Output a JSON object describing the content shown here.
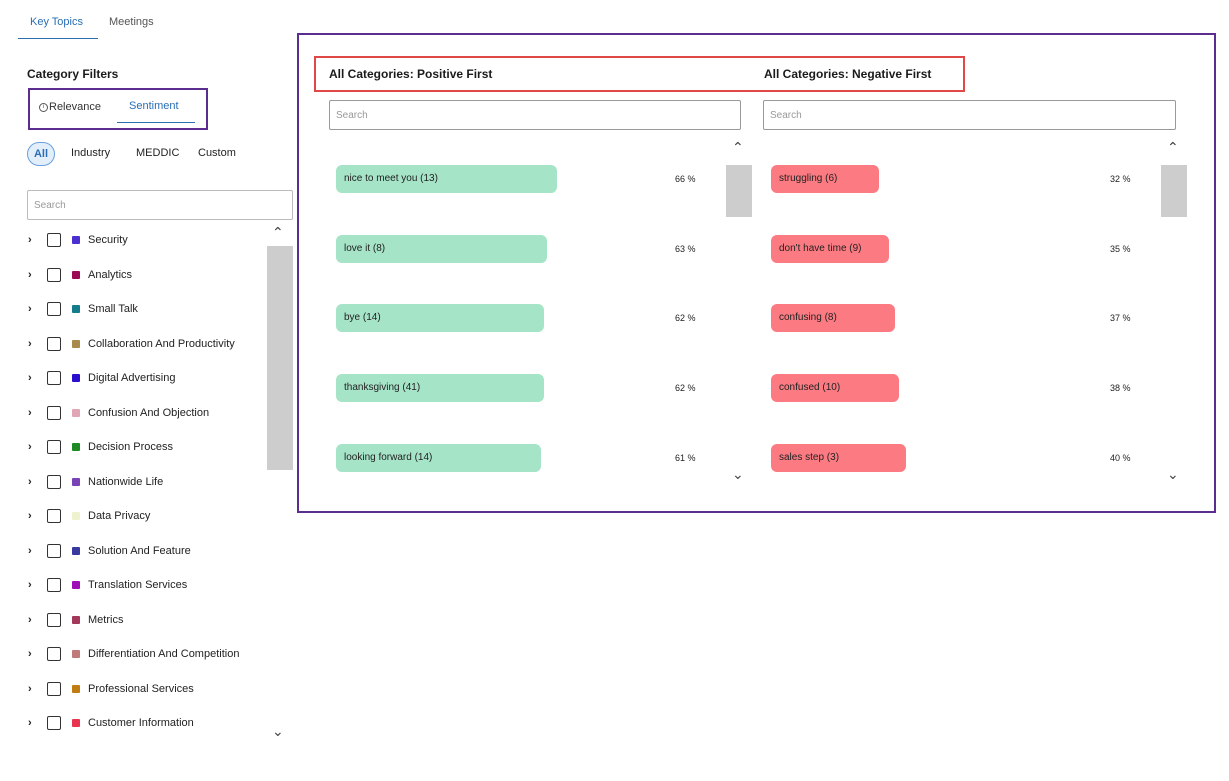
{
  "tabs": {
    "key_topics": "Key Topics",
    "meetings": "Meetings"
  },
  "category_filters": {
    "title": "Category Filters",
    "mode": {
      "relevance": "Relevance",
      "sentiment": "Sentiment"
    },
    "chips": {
      "all": "All",
      "industry": "Industry",
      "meddic": "MEDDIC",
      "custom": "Custom"
    },
    "search_placeholder": "Search",
    "categories": [
      {
        "label": "Security",
        "color": "#4b2fcf"
      },
      {
        "label": "Analytics",
        "color": "#9b0b55"
      },
      {
        "label": "Small Talk",
        "color": "#147c8a"
      },
      {
        "label": "Collaboration And Productivity",
        "color": "#a88a4a"
      },
      {
        "label": "Digital Advertising",
        "color": "#2a0fcf"
      },
      {
        "label": "Confusion And Objection",
        "color": "#e0a6b6"
      },
      {
        "label": "Decision Process",
        "color": "#1e8a22"
      },
      {
        "label": "Nationwide Life",
        "color": "#7a43b5"
      },
      {
        "label": "Data Privacy",
        "color": "#eef2cf"
      },
      {
        "label": "Solution And Feature",
        "color": "#3a3a9e"
      },
      {
        "label": "Translation Services",
        "color": "#9e0fb5"
      },
      {
        "label": "Metrics",
        "color": "#a3385a"
      },
      {
        "label": "Differentiation And Competition",
        "color": "#c07a7a"
      },
      {
        "label": "Professional Services",
        "color": "#c07b12"
      },
      {
        "label": "Customer Information",
        "color": "#e8344f"
      }
    ]
  },
  "positive": {
    "title": "All Categories: Positive First",
    "search_placeholder": "Search",
    "items": [
      {
        "label": "nice to meet you (13)",
        "pct": "66 %",
        "value": 66
      },
      {
        "label": "love it (8)",
        "pct": "63 %",
        "value": 63
      },
      {
        "label": "bye (14)",
        "pct": "62 %",
        "value": 62
      },
      {
        "label": "thanksgiving (41)",
        "pct": "62 %",
        "value": 62
      },
      {
        "label": "looking forward (14)",
        "pct": "61 %",
        "value": 61
      }
    ]
  },
  "negative": {
    "title": "All Categories: Negative First",
    "search_placeholder": "Search",
    "items": [
      {
        "label": "struggling (6)",
        "pct": "32 %",
        "value": 32
      },
      {
        "label": "don't have time (9)",
        "pct": "35 %",
        "value": 35
      },
      {
        "label": "confusing (8)",
        "pct": "37 %",
        "value": 37
      },
      {
        "label": "confused (10)",
        "pct": "38 %",
        "value": 38
      },
      {
        "label": "sales step (3)",
        "pct": "40 %",
        "value": 40
      }
    ]
  },
  "icons": {
    "info": "info-icon",
    "expand": "chevron-right-icon",
    "scroll_up": "chevron-up-icon",
    "scroll_down": "chevron-down-icon"
  }
}
